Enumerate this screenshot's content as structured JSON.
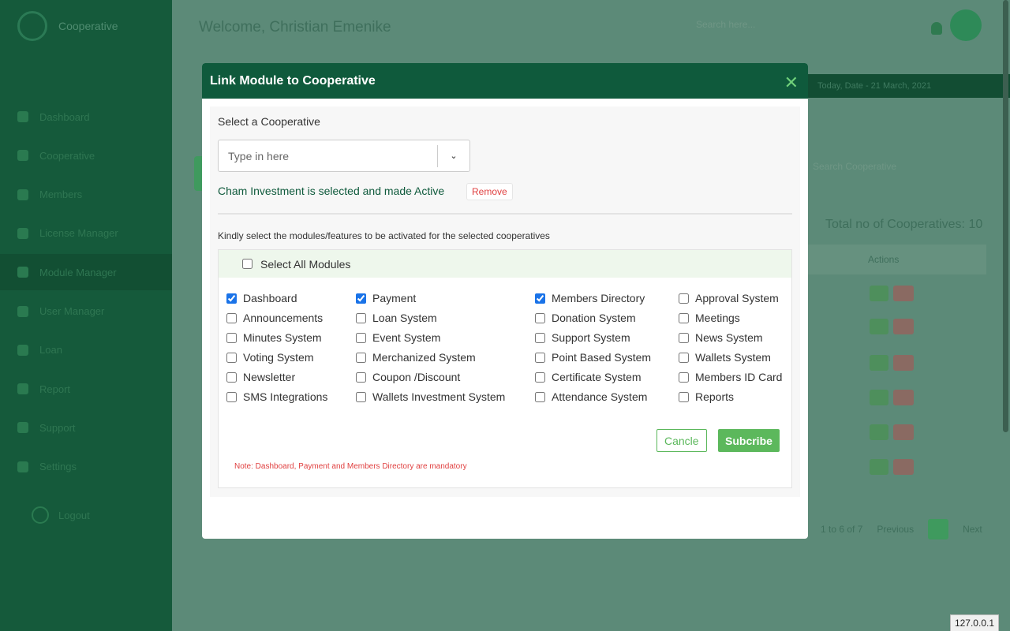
{
  "background": {
    "brand": "Cooperative",
    "welcome": "Welcome, Christian Emenike",
    "search_placeholder": "Search here...",
    "sidebar_items": [
      "Dashboard",
      "Cooperative",
      "Members",
      "License Manager",
      "Module Manager",
      "User Manager",
      "Loan",
      "Report",
      "Support",
      "Settings"
    ],
    "active_sidebar_index": 4,
    "logout": "Logout",
    "top_band_text": "Today, Date - 21 March, 2021",
    "filter_text": "Search Cooperative",
    "total_label": "Total no of Cooperatives: 10",
    "table_header_actions": "Actions",
    "pager": {
      "showing": "1 to 6 of 7",
      "previous": "Previous",
      "next": "Next"
    },
    "url_tag": "127.0.0.1"
  },
  "modal": {
    "title": "Link Module to Cooperative",
    "close_icon": "close-icon",
    "select_label": "Select a Cooperative",
    "search_placeholder": "Type in here",
    "selected_status": "Cham Investment is selected and made Active",
    "remove_label": "Remove",
    "instruction": "Kindly select the modules/features to be activated for the selected cooperatives",
    "select_all_label": "Select All Modules",
    "select_all_checked": false,
    "modules": [
      {
        "label": "Dashboard",
        "checked": true
      },
      {
        "label": "Payment",
        "checked": true
      },
      {
        "label": "Members Directory",
        "checked": true
      },
      {
        "label": "Approval System",
        "checked": false
      },
      {
        "label": "Announcements",
        "checked": false
      },
      {
        "label": "Loan System",
        "checked": false
      },
      {
        "label": "Donation System",
        "checked": false
      },
      {
        "label": "Meetings",
        "checked": false
      },
      {
        "label": "Minutes System",
        "checked": false
      },
      {
        "label": "Event System",
        "checked": false
      },
      {
        "label": "Support System",
        "checked": false
      },
      {
        "label": "News System",
        "checked": false
      },
      {
        "label": "Voting System",
        "checked": false
      },
      {
        "label": "Merchanized System",
        "checked": false
      },
      {
        "label": "Point Based System",
        "checked": false
      },
      {
        "label": "Wallets System",
        "checked": false
      },
      {
        "label": "Newsletter",
        "checked": false
      },
      {
        "label": "Coupon /Discount",
        "checked": false
      },
      {
        "label": "Certificate System",
        "checked": false
      },
      {
        "label": "Members ID Card",
        "checked": false
      },
      {
        "label": "SMS Integrations",
        "checked": false
      },
      {
        "label": "Wallets Investment System",
        "checked": false
      },
      {
        "label": "Attendance System",
        "checked": false
      },
      {
        "label": "Reports",
        "checked": false
      }
    ],
    "cancel_label": "Cancle",
    "submit_label": "Subcribe",
    "note": "Note: Dashboard, Payment and Members Directory are mandatory"
  },
  "colors": {
    "header": "#0f5a3c",
    "accent_green": "#5cb85c",
    "danger": "#e04040",
    "overlay": "#5c8a78"
  }
}
